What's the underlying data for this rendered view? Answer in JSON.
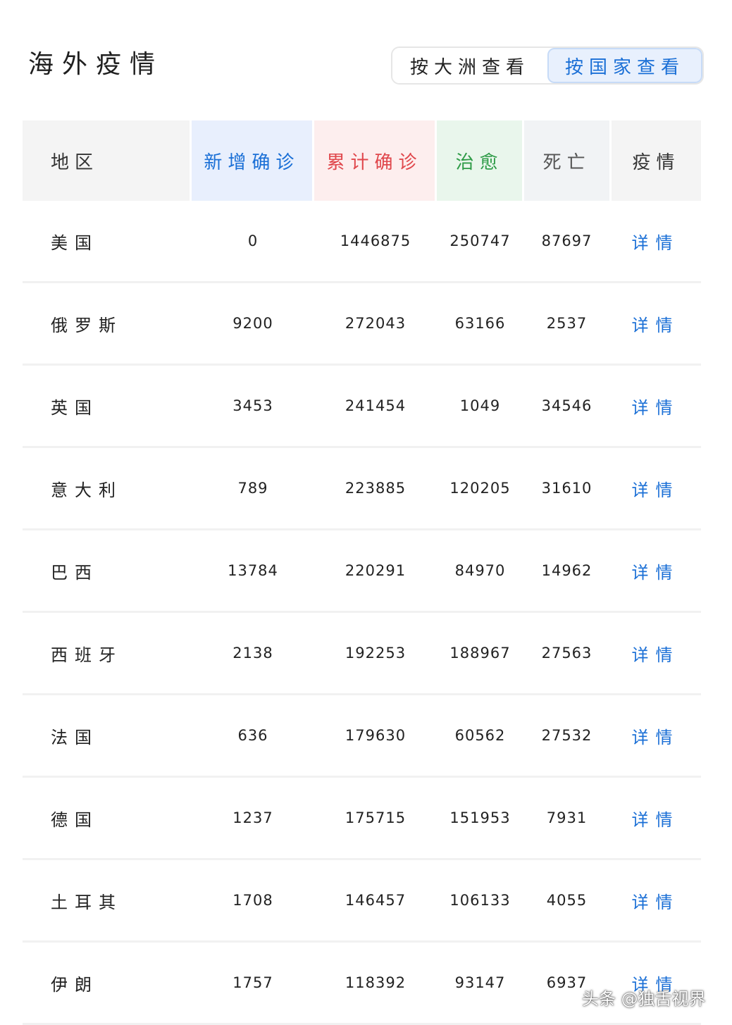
{
  "title": "海外疫情",
  "toggle": {
    "by_continent": "按大洲查看",
    "by_country": "按国家查看",
    "active": "by_country"
  },
  "colors": {
    "accent_blue": "#1a6fd6",
    "confirmed_red": "#e0474c",
    "cured_green": "#2e9b47"
  },
  "table": {
    "headers": {
      "region": "地区",
      "new_confirmed": "新增确诊",
      "total_confirmed": "累计确诊",
      "cured": "治愈",
      "dead": "死亡",
      "detail": "疫情"
    },
    "rows": [
      {
        "region": "美国",
        "new_confirmed": "0",
        "total_confirmed": "1446875",
        "cured": "250747",
        "dead": "87697",
        "detail": "详情"
      },
      {
        "region": "俄罗斯",
        "new_confirmed": "9200",
        "total_confirmed": "272043",
        "cured": "63166",
        "dead": "2537",
        "detail": "详情"
      },
      {
        "region": "英国",
        "new_confirmed": "3453",
        "total_confirmed": "241454",
        "cured": "1049",
        "dead": "34546",
        "detail": "详情"
      },
      {
        "region": "意大利",
        "new_confirmed": "789",
        "total_confirmed": "223885",
        "cured": "120205",
        "dead": "31610",
        "detail": "详情"
      },
      {
        "region": "巴西",
        "new_confirmed": "13784",
        "total_confirmed": "220291",
        "cured": "84970",
        "dead": "14962",
        "detail": "详情"
      },
      {
        "region": "西班牙",
        "new_confirmed": "2138",
        "total_confirmed": "192253",
        "cured": "188967",
        "dead": "27563",
        "detail": "详情"
      },
      {
        "region": "法国",
        "new_confirmed": "636",
        "total_confirmed": "179630",
        "cured": "60562",
        "dead": "27532",
        "detail": "详情"
      },
      {
        "region": "德国",
        "new_confirmed": "1237",
        "total_confirmed": "175715",
        "cured": "151953",
        "dead": "7931",
        "detail": "详情"
      },
      {
        "region": "土耳其",
        "new_confirmed": "1708",
        "total_confirmed": "146457",
        "cured": "106133",
        "dead": "4055",
        "detail": "详情"
      },
      {
        "region": "伊朗",
        "new_confirmed": "1757",
        "total_confirmed": "118392",
        "cured": "93147",
        "dead": "6937",
        "detail": "详情"
      }
    ]
  },
  "watermark": "头条 @独舌视界"
}
